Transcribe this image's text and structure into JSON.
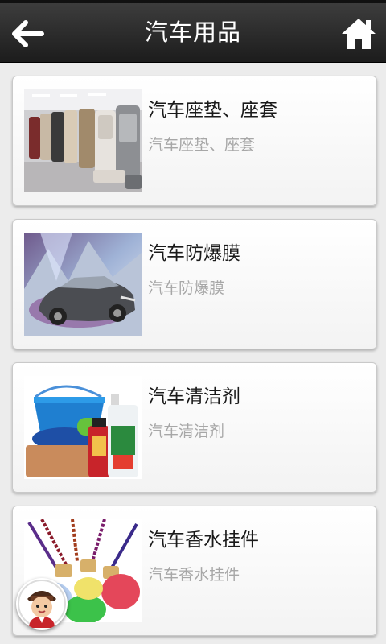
{
  "header": {
    "title": "汽车用品",
    "back_icon": "arrow-left-icon",
    "home_icon": "home-icon"
  },
  "items": [
    {
      "title": "汽车座垫、座套",
      "subtitle": "汽车座垫、座套",
      "image": "car-seat-covers-photo"
    },
    {
      "title": "汽车防爆膜",
      "subtitle": "汽车防爆膜",
      "image": "car-window-film-photo"
    },
    {
      "title": "汽车清洁剂",
      "subtitle": "汽车清洁剂",
      "image": "car-cleaning-supplies-photo"
    },
    {
      "title": "汽车香水挂件",
      "subtitle": "汽车香水挂件",
      "image": "car-perfume-pendants-photo"
    }
  ],
  "floating_button": {
    "icon": "assistant-avatar-icon"
  },
  "colors": {
    "header_bg": "#2a2a2a",
    "title_text": "#1a1a1a",
    "subtitle_text": "#a7a7a7",
    "page_bg": "#ececec"
  }
}
